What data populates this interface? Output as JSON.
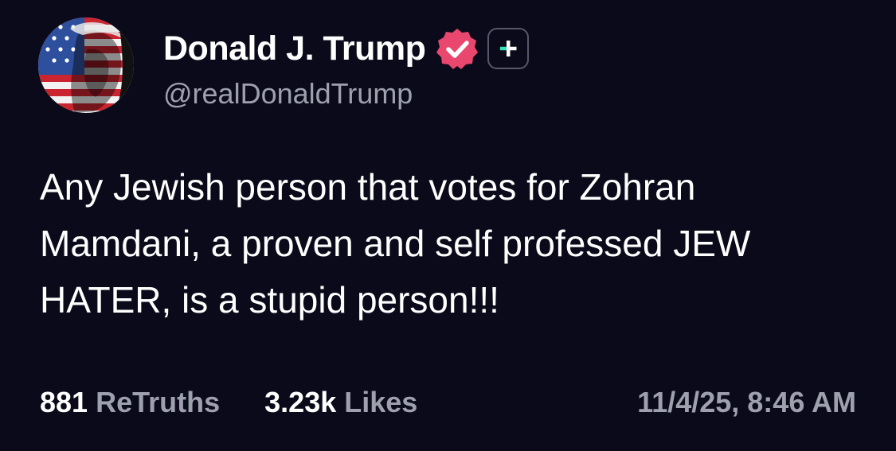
{
  "author": {
    "display_name": "Donald J. Trump",
    "handle": "@realDonaldTrump",
    "avatar_icon": "flag-portrait-avatar",
    "verified_icon": "verified-badge-icon",
    "verified_color": "#e9476e",
    "follow_icon": "plus-icon",
    "follow_accent": "#2ee6b8"
  },
  "post": {
    "text": "Any Jewish person that votes for Zohran Mamdani, a proven and self professed JEW HATER, is a stupid person!!!"
  },
  "stats": {
    "retruths_count": "881",
    "retruths_label": "ReTruths",
    "likes_count": "3.23k",
    "likes_label": "Likes",
    "timestamp": "11/4/25, 8:46 AM"
  },
  "colors": {
    "background": "#0b0a1a",
    "text_primary": "#ffffff",
    "text_secondary": "#9ea0ad"
  }
}
